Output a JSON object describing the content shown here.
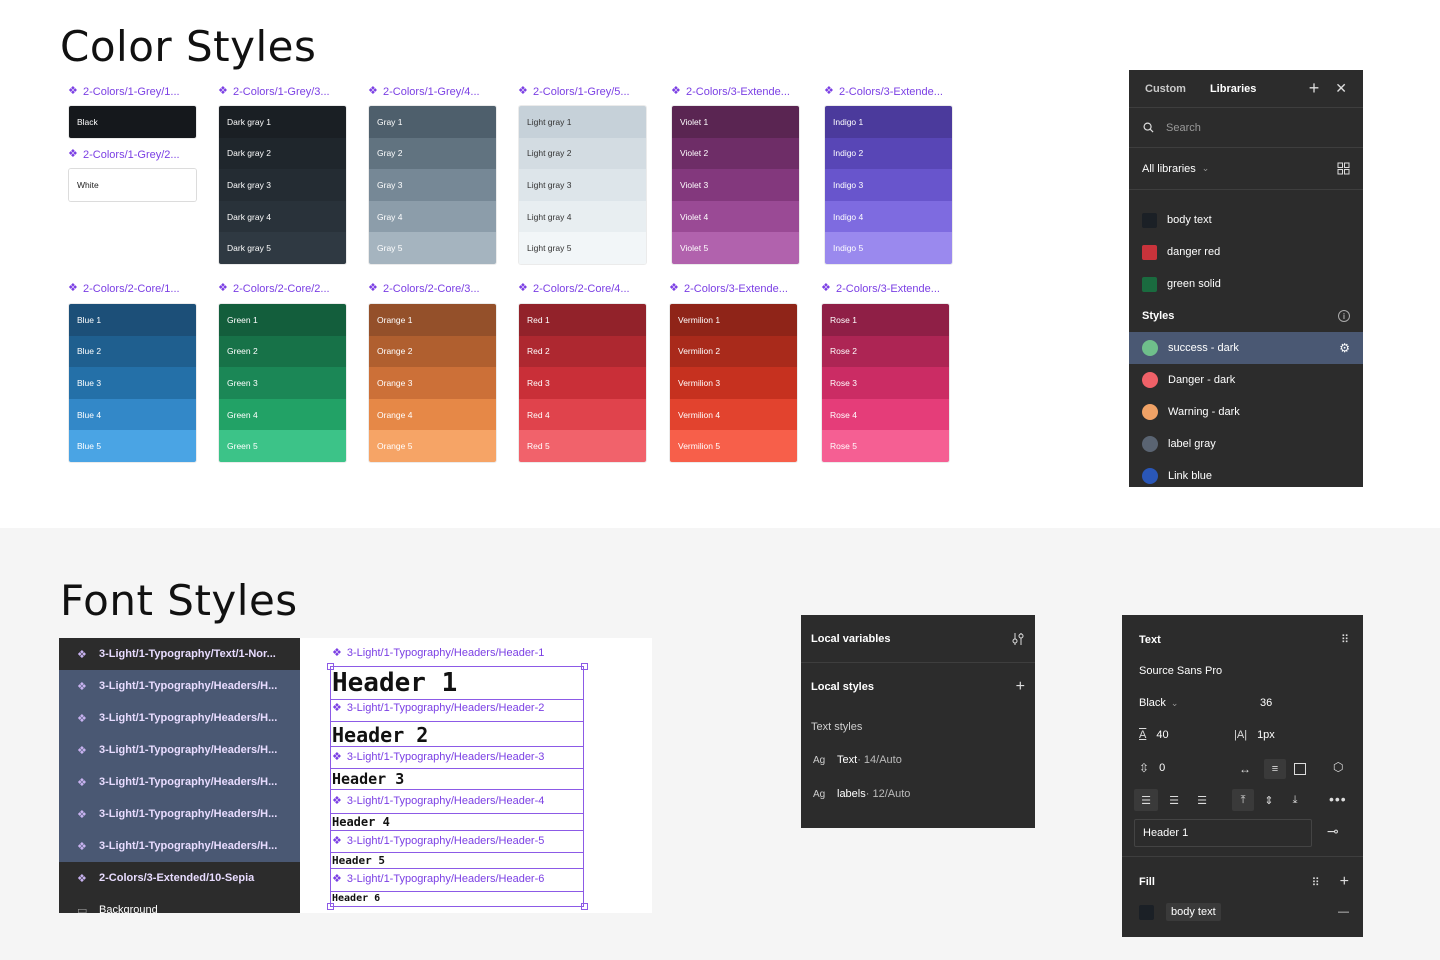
{
  "titles": {
    "color_styles": "Color Styles",
    "font_styles": "Font Styles"
  },
  "swatches_top": [
    {
      "label": "2-Colors/1-Grey/1...",
      "rows": [
        {
          "name": "Black",
          "bg": "#15181c",
          "fg": "#ffffff"
        }
      ],
      "label2": "2-Colors/1-Grey/2...",
      "rows2": [
        {
          "name": "White",
          "bg": "#ffffff",
          "fg": "#222222"
        }
      ]
    },
    {
      "label": "2-Colors/1-Grey/3...",
      "rows": [
        {
          "name": "Dark gray 1",
          "bg": "#1a1f24",
          "fg": "#ffffff"
        },
        {
          "name": "Dark gray 2",
          "bg": "#1f262c",
          "fg": "#ffffff"
        },
        {
          "name": "Dark gray 3",
          "bg": "#242c33",
          "fg": "#ffffff"
        },
        {
          "name": "Dark gray 4",
          "bg": "#29323a",
          "fg": "#ffffff"
        },
        {
          "name": "Dark gray 5",
          "bg": "#2f3942",
          "fg": "#ffffff"
        }
      ]
    },
    {
      "label": "2-Colors/1-Grey/4...",
      "rows": [
        {
          "name": "Gray 1",
          "bg": "#4e5f6c",
          "fg": "#ffffff"
        },
        {
          "name": "Gray 2",
          "bg": "#617380",
          "fg": "#ffffff"
        },
        {
          "name": "Gray 3",
          "bg": "#768896",
          "fg": "#ffffff"
        },
        {
          "name": "Gray 4",
          "bg": "#8c9daa",
          "fg": "#ffffff"
        },
        {
          "name": "Gray 5",
          "bg": "#a5b4bf",
          "fg": "#ffffff"
        }
      ]
    },
    {
      "label": "2-Colors/1-Grey/5...",
      "rows": [
        {
          "name": "Light gray 1",
          "bg": "#c6d1d9",
          "fg": "#333333"
        },
        {
          "name": "Light gray 2",
          "bg": "#d3dce2",
          "fg": "#333333"
        },
        {
          "name": "Light gray 3",
          "bg": "#dde5ea",
          "fg": "#333333"
        },
        {
          "name": "Light gray 4",
          "bg": "#e8eef1",
          "fg": "#333333"
        },
        {
          "name": "Light gray 5",
          "bg": "#f2f6f8",
          "fg": "#333333"
        }
      ]
    },
    {
      "label": "2-Colors/3-Extende...",
      "rows": [
        {
          "name": "Violet 1",
          "bg": "#5a2552",
          "fg": "#ffffff"
        },
        {
          "name": "Violet 2",
          "bg": "#6e2d67",
          "fg": "#ffffff"
        },
        {
          "name": "Violet 3",
          "bg": "#83387d",
          "fg": "#ffffff"
        },
        {
          "name": "Violet 4",
          "bg": "#9a4a95",
          "fg": "#ffffff"
        },
        {
          "name": "Violet 5",
          "bg": "#b162ad",
          "fg": "#ffffff"
        }
      ]
    },
    {
      "label": "2-Colors/3-Extende...",
      "rows": [
        {
          "name": "Indigo 1",
          "bg": "#4b3a9c",
          "fg": "#ffffff"
        },
        {
          "name": "Indigo 2",
          "bg": "#5846b6",
          "fg": "#ffffff"
        },
        {
          "name": "Indigo 3",
          "bg": "#6855cc",
          "fg": "#ffffff"
        },
        {
          "name": "Indigo 4",
          "bg": "#7e6be0",
          "fg": "#ffffff"
        },
        {
          "name": "Indigo 5",
          "bg": "#9a89ee",
          "fg": "#ffffff"
        }
      ]
    }
  ],
  "swatches_bottom": [
    {
      "label": "2-Colors/2-Core/1...",
      "rows": [
        {
          "name": "Blue 1",
          "bg": "#1c4f78",
          "fg": "#ffffff"
        },
        {
          "name": "Blue 2",
          "bg": "#1f5f8f",
          "fg": "#ffffff"
        },
        {
          "name": "Blue 3",
          "bg": "#2470a8",
          "fg": "#ffffff"
        },
        {
          "name": "Blue 4",
          "bg": "#3388c8",
          "fg": "#ffffff"
        },
        {
          "name": "Blue 5",
          "bg": "#4aa4e4",
          "fg": "#ffffff"
        }
      ]
    },
    {
      "label": "2-Colors/2-Core/2...",
      "rows": [
        {
          "name": "Green 1",
          "bg": "#135e3c",
          "fg": "#ffffff"
        },
        {
          "name": "Green 2",
          "bg": "#177248",
          "fg": "#ffffff"
        },
        {
          "name": "Green 3",
          "bg": "#1b8756",
          "fg": "#ffffff"
        },
        {
          "name": "Green 4",
          "bg": "#22a266",
          "fg": "#ffffff"
        },
        {
          "name": "Green 5",
          "bg": "#3cc388",
          "fg": "#ffffff"
        }
      ]
    },
    {
      "label": "2-Colors/2-Core/3...",
      "rows": [
        {
          "name": "Orange 1",
          "bg": "#94502a",
          "fg": "#ffffff"
        },
        {
          "name": "Orange 2",
          "bg": "#b05f2f",
          "fg": "#ffffff"
        },
        {
          "name": "Orange 3",
          "bg": "#cc7038",
          "fg": "#ffffff"
        },
        {
          "name": "Orange 4",
          "bg": "#e68847",
          "fg": "#ffffff"
        },
        {
          "name": "Orange 5",
          "bg": "#f6a466",
          "fg": "#ffffff"
        }
      ]
    },
    {
      "label": "2-Colors/2-Core/4...",
      "rows": [
        {
          "name": "Red 1",
          "bg": "#92222a",
          "fg": "#ffffff"
        },
        {
          "name": "Red 2",
          "bg": "#ae2830",
          "fg": "#ffffff"
        },
        {
          "name": "Red 3",
          "bg": "#c92f38",
          "fg": "#ffffff"
        },
        {
          "name": "Red 4",
          "bg": "#e0434c",
          "fg": "#ffffff"
        },
        {
          "name": "Red 5",
          "bg": "#f1626b",
          "fg": "#ffffff"
        }
      ]
    },
    {
      "label": "2-Colors/3-Extende...",
      "rows": [
        {
          "name": "Vermilion 1",
          "bg": "#8f2418",
          "fg": "#ffffff"
        },
        {
          "name": "Vermilion 2",
          "bg": "#a92a1b",
          "fg": "#ffffff"
        },
        {
          "name": "Vermilion 3",
          "bg": "#c6311f",
          "fg": "#ffffff"
        },
        {
          "name": "Vermilion 4",
          "bg": "#e2432e",
          "fg": "#ffffff"
        },
        {
          "name": "Vermilion 5",
          "bg": "#f75f4a",
          "fg": "#ffffff"
        }
      ]
    },
    {
      "label": "2-Colors/3-Extende...",
      "rows": [
        {
          "name": "Rose 1",
          "bg": "#8f1f46",
          "fg": "#ffffff"
        },
        {
          "name": "Rose 2",
          "bg": "#ad2554",
          "fg": "#ffffff"
        },
        {
          "name": "Rose 3",
          "bg": "#cb2c64",
          "fg": "#ffffff"
        },
        {
          "name": "Rose 4",
          "bg": "#e53d79",
          "fg": "#ffffff"
        },
        {
          "name": "Rose 5",
          "bg": "#f55f93",
          "fg": "#ffffff"
        }
      ]
    }
  ],
  "libraries_panel": {
    "tab_custom": "Custom",
    "tab_libraries": "Libraries",
    "add": "+",
    "close": "✕",
    "search_placeholder": "Search",
    "filter": "All libraries",
    "variables": [
      {
        "name": "body text",
        "color": "#1b2026"
      },
      {
        "name": "danger red",
        "color": "#c9333b"
      },
      {
        "name": "green solid",
        "color": "#1a6b3f"
      }
    ],
    "styles_heading": "Styles",
    "info_symbol": "i",
    "styles": [
      {
        "name": "success - dark",
        "color": "#6fbf8b",
        "selected": true
      },
      {
        "name": "Danger - dark",
        "color": "#ef6168",
        "selected": false
      },
      {
        "name": "Warning - dark",
        "color": "#f0a266",
        "selected": false
      },
      {
        "name": "label gray",
        "color": "#5a6472",
        "selected": false
      },
      {
        "name": "Link blue",
        "color": "#2a57b8",
        "selected": false
      }
    ]
  },
  "layers": [
    {
      "name": "3-Light/1-Typography/Text/1-Nor...",
      "selected": false,
      "kind": "component"
    },
    {
      "name": "3-Light/1-Typography/Headers/H...",
      "selected": true,
      "kind": "component"
    },
    {
      "name": "3-Light/1-Typography/Headers/H...",
      "selected": true,
      "kind": "component"
    },
    {
      "name": "3-Light/1-Typography/Headers/H...",
      "selected": true,
      "kind": "component"
    },
    {
      "name": "3-Light/1-Typography/Headers/H...",
      "selected": true,
      "kind": "component"
    },
    {
      "name": "3-Light/1-Typography/Headers/H...",
      "selected": true,
      "kind": "component"
    },
    {
      "name": "3-Light/1-Typography/Headers/H...",
      "selected": true,
      "kind": "component"
    },
    {
      "name": "2-Colors/3-Extended/10-Sepia",
      "selected": false,
      "kind": "component"
    },
    {
      "name": "Background",
      "selected": false,
      "kind": "rect"
    }
  ],
  "headers": [
    {
      "label": "3-Light/1-Typography/Headers/Header-1",
      "text": "Header 1"
    },
    {
      "label": "3-Light/1-Typography/Headers/Header-2",
      "text": "Header 2"
    },
    {
      "label": "3-Light/1-Typography/Headers/Header-3",
      "text": "Header 3"
    },
    {
      "label": "3-Light/1-Typography/Headers/Header-4",
      "text": "Header 4"
    },
    {
      "label": "3-Light/1-Typography/Headers/Header-5",
      "text": "Header 5"
    },
    {
      "label": "3-Light/1-Typography/Headers/Header-6",
      "text": "Header 6"
    }
  ],
  "local_panel": {
    "variables_title": "Local variables",
    "styles_title": "Local styles",
    "add": "+",
    "text_styles_heading": "Text styles",
    "items": [
      {
        "ag": "Ag",
        "name": "Text",
        "meta": " · 14/Auto"
      },
      {
        "ag": "Ag",
        "name": "labels",
        "meta": " · 12/Auto"
      }
    ]
  },
  "text_panel": {
    "title": "Text",
    "font_family": "Source Sans Pro",
    "weight": "Black",
    "size": "36",
    "line_height": "40",
    "letter_spacing": "1px",
    "paragraph_spacing": "0",
    "style_name": "Header 1",
    "fill_title": "Fill",
    "fill_style": "body text",
    "fill_color": "#1b2026",
    "minus": "—",
    "plus": "+"
  }
}
